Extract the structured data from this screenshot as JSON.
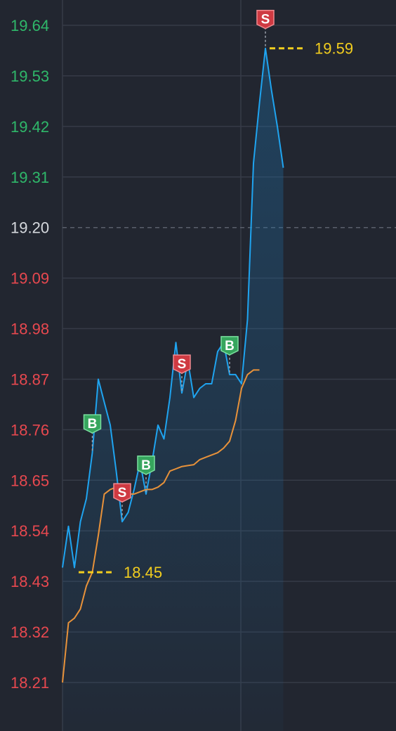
{
  "chart_data": {
    "type": "line",
    "y_ticks": [
      "19.64",
      "19.53",
      "19.42",
      "19.31",
      "19.20",
      "19.09",
      "18.98",
      "18.87",
      "18.76",
      "18.65",
      "18.54",
      "18.43",
      "18.32",
      "18.21"
    ],
    "reference_price": "19.20",
    "ylim": [
      18.21,
      19.64
    ],
    "grid": true,
    "series": [
      {
        "values": [
          18.46,
          18.55,
          18.46,
          18.56,
          18.61,
          18.71,
          18.87,
          18.82,
          18.77,
          18.67,
          18.56,
          18.58,
          18.63,
          18.69,
          18.62,
          18.69,
          18.77,
          18.74,
          18.83,
          18.95,
          18.84,
          18.91,
          18.83,
          18.85,
          18.86,
          18.86,
          18.93,
          18.95,
          18.88,
          18.88,
          18.86,
          19.0,
          19.34,
          19.47,
          19.59,
          19.5,
          19.42,
          19.33
        ],
        "color": "#1fa4f0",
        "fill": true
      },
      {
        "values": [
          18.21,
          18.34,
          18.35,
          18.37,
          18.42,
          18.45,
          18.53,
          18.62,
          18.63,
          18.635,
          18.63,
          18.62,
          18.62,
          18.625,
          18.63,
          18.63,
          18.635,
          18.645,
          18.67,
          18.675,
          18.68,
          18.682,
          18.684,
          18.695,
          18.7,
          18.705,
          18.71,
          18.72,
          18.735,
          18.78,
          18.85,
          18.88,
          18.89,
          18.89
        ],
        "color": "#e8923a",
        "x_offset": 0
      }
    ],
    "markers": [
      {
        "label": "B",
        "index": 5,
        "kind": "buy"
      },
      {
        "label": "S",
        "index": 10,
        "kind": "sell"
      },
      {
        "label": "B",
        "index": 14,
        "kind": "buy"
      },
      {
        "label": "S",
        "index": 20,
        "kind": "sell"
      },
      {
        "label": "B",
        "index": 28,
        "kind": "buy"
      },
      {
        "label": "S",
        "index": 34,
        "kind": "sell"
      }
    ],
    "annotations": [
      {
        "text": "19.59",
        "value": 19.59,
        "anchor_index": 34,
        "side": "right"
      },
      {
        "text": "18.45",
        "value": 18.45,
        "anchor_index": 2,
        "side": "right"
      }
    ],
    "colors": {
      "background": "#222630",
      "grid": "#363b47",
      "up_label": "#2fb86a",
      "down_label": "#e8484f",
      "ref_label": "#d6d9de",
      "annotation": "#f2cd1e",
      "buy": "#36a55d",
      "sell": "#cf3a42"
    }
  }
}
